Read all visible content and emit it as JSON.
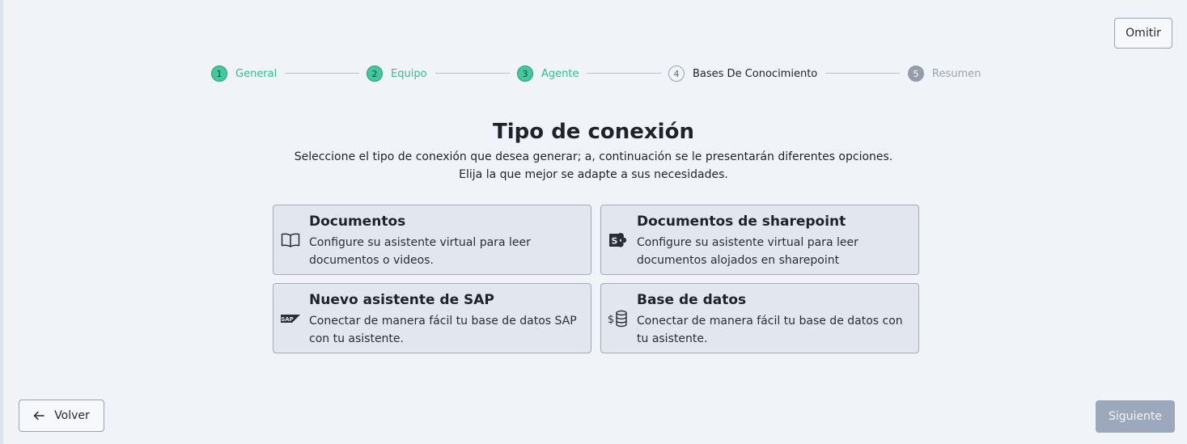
{
  "header": {
    "skip_label": "Omitir"
  },
  "stepper": {
    "steps": [
      {
        "number": "1",
        "label": "General",
        "state": "completed"
      },
      {
        "number": "2",
        "label": "Equipo",
        "state": "completed"
      },
      {
        "number": "3",
        "label": "Agente",
        "state": "completed"
      },
      {
        "number": "4",
        "label": "Bases De Conocimiento",
        "state": "current"
      },
      {
        "number": "5",
        "label": "Resumen",
        "state": "pending"
      }
    ]
  },
  "main": {
    "title": "Tipo de conexión",
    "subtitle_line1": "Seleccione el tipo de conexión que desea generar; a, continuación se le presentarán diferentes opciones.",
    "subtitle_line2": "Elija la que mejor se adapte a sus necesidades."
  },
  "options": [
    {
      "title": "Documentos",
      "description": "Configure su asistente virtual para leer documentos o videos.",
      "icon": "book-icon"
    },
    {
      "title": "Documentos de sharepoint",
      "description": "Configure su asistente virtual para leer documentos alojados en sharepoint",
      "icon": "sharepoint-icon"
    },
    {
      "title": "Nuevo asistente de SAP",
      "description": "Conectar de manera fácil tu base de datos SAP con tu asistente.",
      "icon": "sap-icon",
      "icon_text": "SAP"
    },
    {
      "title": "Base de datos",
      "description": "Conectar de manera fácil tu base de datos con tu asistente.",
      "icon": "database-dollar-icon"
    }
  ],
  "footer": {
    "back_label": "Volver",
    "next_label": "Siguiente"
  },
  "colors": {
    "completed": "#43c79c",
    "pending": "#959daa",
    "next_disabled": "#9ca8bb",
    "card_bg": "#e2e7ef"
  }
}
